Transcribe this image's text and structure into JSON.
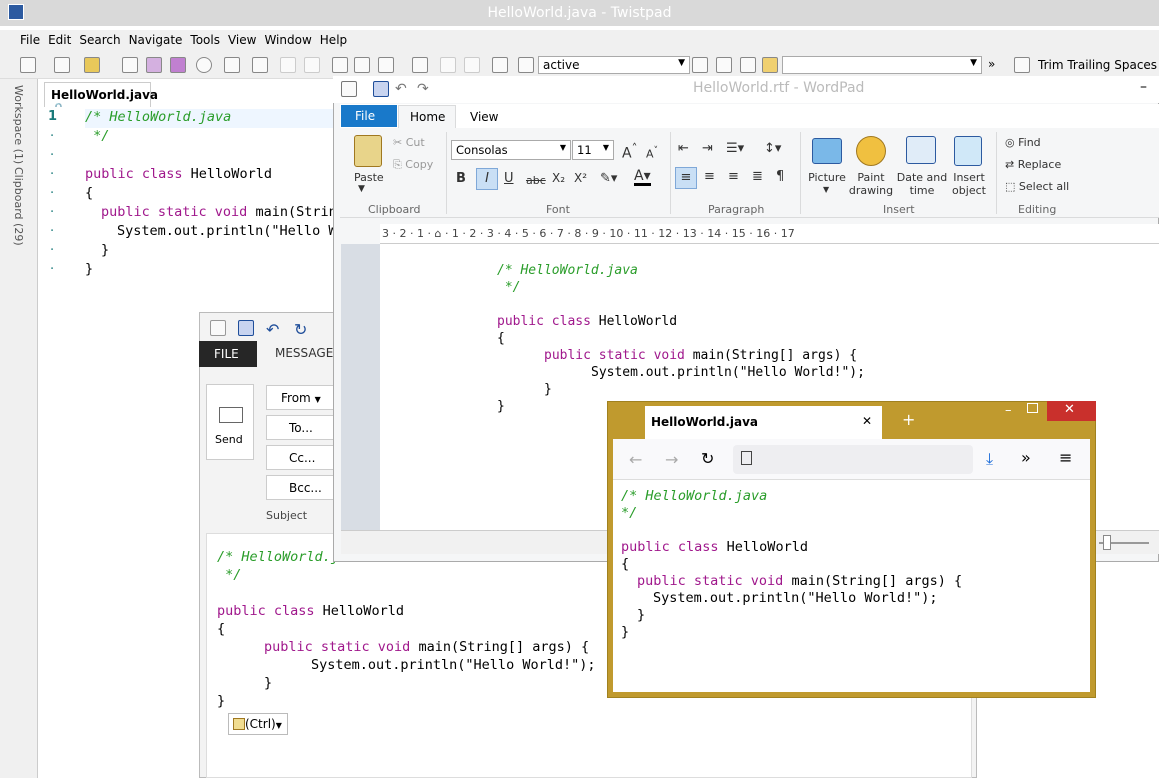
{
  "twistpad": {
    "title": "HelloWorld.java  -  Twistpad",
    "menu": [
      "File",
      "Edit",
      "Search",
      "Navigate",
      "Tools",
      "View",
      "Window",
      "Help"
    ],
    "combo_value": "active",
    "trim_label": "Trim Trailing Spaces",
    "side_tabs": [
      "Workspace (1)",
      "Clipboard (29)"
    ],
    "tab_label": "HelloWorld.java",
    "line_number": "1",
    "code": [
      "/* HelloWorld.java",
      " */",
      "",
      "public class HelloWorld",
      "{",
      "public static void main(Strin",
      "System.out.println(\"Hello W",
      "}",
      "}"
    ]
  },
  "outlook": {
    "file_tab": "FILE",
    "message_tab": "MESSAGE",
    "send": "Send",
    "from": "From",
    "to": "To...",
    "cc": "Cc...",
    "bcc": "Bcc...",
    "subject": "Subject",
    "paste_ctrl": "(Ctrl)",
    "code": [
      "/* HelloWorld.j",
      " */",
      "",
      "public class HelloWorld",
      "{",
      "public static void main(String[] args) {",
      "System.out.println(\"Hello World!\");",
      "}",
      "}"
    ]
  },
  "wordpad": {
    "title": "HelloWorld.rtf - WordPad",
    "tabs": {
      "file": "File",
      "home": "Home",
      "view": "View"
    },
    "clipboard": {
      "paste": "Paste",
      "cut": "Cut",
      "copy": "Copy",
      "group": "Clipboard"
    },
    "font": {
      "name": "Consolas",
      "size": "11",
      "group": "Font"
    },
    "paragraph_group": "Paragraph",
    "insert": {
      "picture": "Picture",
      "paint": "Paint drawing",
      "datetime": "Date and time",
      "object": "Insert object",
      "group": "Insert"
    },
    "editing": {
      "find": "Find",
      "replace": "Replace",
      "select_all": "Select all",
      "group": "Editing"
    },
    "ruler": "3 · 2 · 1 · ⌂ · 1 · 2 · 3 · 4 · 5 · 6 · 7 · 8 · 9 · 10 · 11 · 12 · 13 · 14 · 15 · 16 · 17",
    "code": [
      "/* HelloWorld.java",
      " */",
      "",
      "public class HelloWorld",
      "{",
      "public static void main(String[] args) {",
      "System.out.println(\"Hello World!\");",
      "}",
      "}"
    ]
  },
  "browser": {
    "tab_title": "HelloWorld.java",
    "new_tab": "+",
    "code": [
      "/* HelloWorld.java",
      "*/",
      "",
      "public class HelloWorld",
      "{",
      "public static void main(String[] args) {",
      "System.out.println(\"Hello World!\");",
      "}",
      "}"
    ]
  }
}
